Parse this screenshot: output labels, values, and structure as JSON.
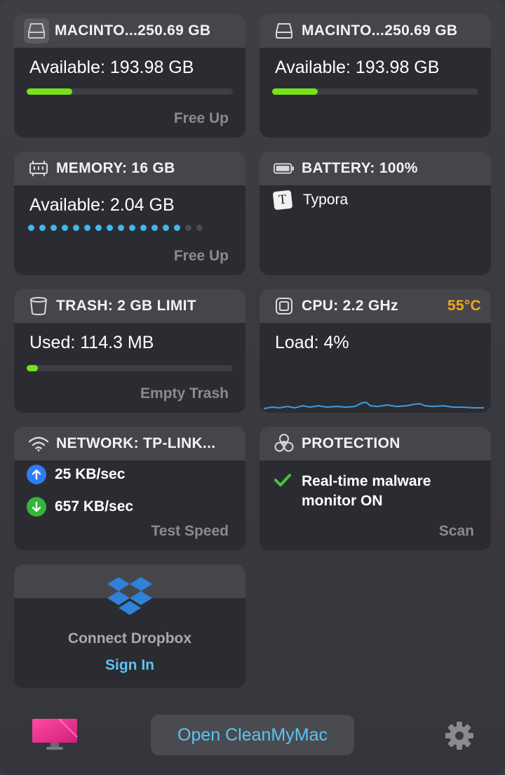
{
  "disk1": {
    "title": "MACINTO...250.69 GB",
    "available": "Available: 193.98 GB",
    "usage_fraction": 0.22,
    "action": "Free Up"
  },
  "disk2": {
    "title": "MACINTO...250.69 GB",
    "available": "Available: 193.98 GB",
    "usage_fraction": 0.22
  },
  "memory": {
    "title": "MEMORY: 16 GB",
    "available": "Available: 2.04 GB",
    "dots_total": 16,
    "dots_active": 14,
    "action": "Free Up"
  },
  "battery": {
    "title": "BATTERY: 100%",
    "app": "Typora",
    "app_icon_letter": "T"
  },
  "trash": {
    "title": "TRASH: 2 GB LIMIT",
    "used": "Used: 114.3 MB",
    "usage_fraction": 0.055,
    "action": "Empty Trash"
  },
  "cpu": {
    "title": "CPU: 2.2 GHz",
    "temp": "55°C",
    "load": "Load: 4%"
  },
  "network": {
    "title": "NETWORK: TP-LINK...",
    "upload": "25 KB/sec",
    "download": "657 KB/sec",
    "action": "Test Speed"
  },
  "protection": {
    "title": "PROTECTION",
    "status": "Real-time malware monitor ON",
    "action": "Scan"
  },
  "dropbox": {
    "label": "Connect Dropbox",
    "action": "Sign In"
  },
  "footer": {
    "open_button": "Open CleanMyMac"
  },
  "colors": {
    "accent_green": "#77e11b",
    "accent_blue": "#5bc4f2",
    "temp_orange": "#f0a81a",
    "dot_blue": "#3fb8ee",
    "upload_blue": "#2f7cf6",
    "download_green": "#35b53a"
  },
  "icons": [
    "disk-icon",
    "disk-icon",
    "memory-chip-icon",
    "battery-icon",
    "trash-icon",
    "cpu-icon",
    "wifi-icon",
    "biohazard-icon",
    "dropbox-icon",
    "cleanmymac-logo-icon",
    "gear-icon"
  ]
}
